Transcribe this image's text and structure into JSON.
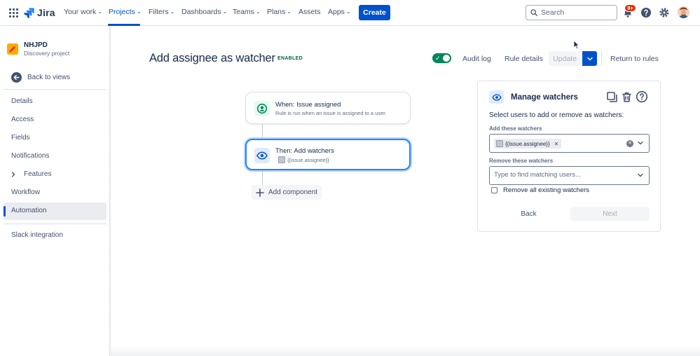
{
  "topnav": {
    "logo": "Jira",
    "items": [
      {
        "label": "Your work",
        "chevron": true
      },
      {
        "label": "Projects",
        "chevron": true,
        "active": true
      },
      {
        "label": "Filters",
        "chevron": true
      },
      {
        "label": "Dashboards",
        "chevron": true
      },
      {
        "label": "Teams",
        "chevron": true
      },
      {
        "label": "Plans",
        "chevron": true
      },
      {
        "label": "Assets",
        "chevron": false
      },
      {
        "label": "Apps",
        "chevron": true
      }
    ],
    "create_label": "Create",
    "search_placeholder": "Search",
    "notification_badge": "9+",
    "icons": [
      "apps-grid-icon",
      "jira-logo-icon",
      "search-icon",
      "bell-icon",
      "help-icon",
      "gear-icon"
    ]
  },
  "sidebar": {
    "project_name": "NHJPD",
    "project_type": "Discovery project",
    "back_label": "Back to views",
    "items": [
      {
        "label": "Details"
      },
      {
        "label": "Access"
      },
      {
        "label": "Fields"
      },
      {
        "label": "Notifications"
      },
      {
        "label": "Features",
        "expandable": true
      },
      {
        "label": "Workflow"
      },
      {
        "label": "Automation",
        "active": true
      },
      {
        "label": "Slack integration"
      }
    ]
  },
  "header": {
    "title": "Add assignee as watcher",
    "status": "ENABLED",
    "toggle_on": true,
    "audit_log": "Audit log",
    "rule_details": "Rule details",
    "update": "Update",
    "return": "Return to rules"
  },
  "rule": {
    "trigger": {
      "title": "When: Issue assigned",
      "subtitle": "Rule is run when an issue is assigned to a user."
    },
    "action": {
      "title": "Then: Add watchers",
      "subtitle": "{{issue.assignee}}"
    },
    "add_component": "Add component"
  },
  "panel": {
    "title": "Manage watchers",
    "description": "Select users to add or remove as watchers:",
    "add_label": "Add these watchers",
    "add_chip": "{{issue.assignee}}",
    "remove_label": "Remove these watchers",
    "remove_placeholder": "Type to find matching users...",
    "remove_all": "Remove all existing watchers",
    "remove_all_checked": false,
    "back": "Back",
    "next": "Next"
  },
  "colors": {
    "brand": "#0052cc",
    "success": "#00875a",
    "danger": "#de350b",
    "selected": "#2684ff"
  }
}
